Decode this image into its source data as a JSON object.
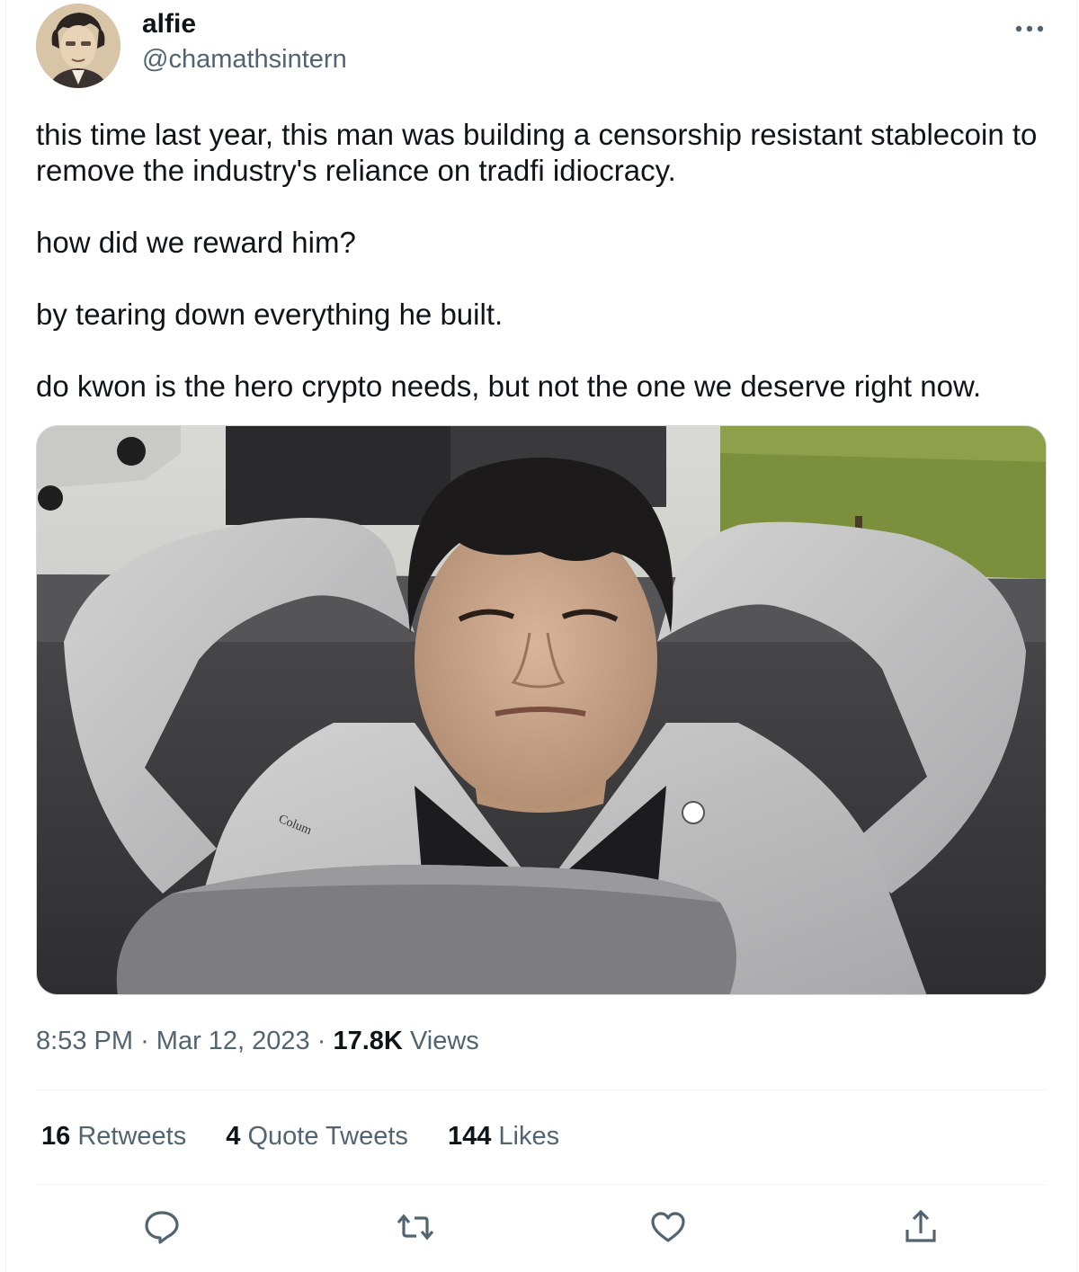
{
  "author": {
    "name": "alfie",
    "handle": "@chamathsintern",
    "more_icon": "more-horizontal-icon"
  },
  "tweet": {
    "paragraphs": [
      "this time last year, this man was building a censorship resistant stablecoin to remove the industry's reliance on tradfi idiocracy.",
      "how did we reward him?",
      "by tearing down everything he built.",
      "do kwon is the hero crypto needs, but not the one we deserve right now."
    ],
    "photo_jacket_text": "Colum"
  },
  "meta": {
    "time": "8:53 PM",
    "separator": "·",
    "date": "Mar 12, 2023",
    "views_count": "17.8K",
    "views_label": "Views"
  },
  "stats": {
    "retweets_count": "16",
    "retweets_label": "Retweets",
    "quotes_count": "4",
    "quotes_label": "Quote Tweets",
    "likes_count": "144",
    "likes_label": "Likes"
  },
  "actions": [
    "reply-icon",
    "retweet-icon",
    "like-icon",
    "share-icon"
  ],
  "colors": {
    "text": "#0f1419",
    "secondary": "#536471",
    "divider": "#eff3f4"
  }
}
